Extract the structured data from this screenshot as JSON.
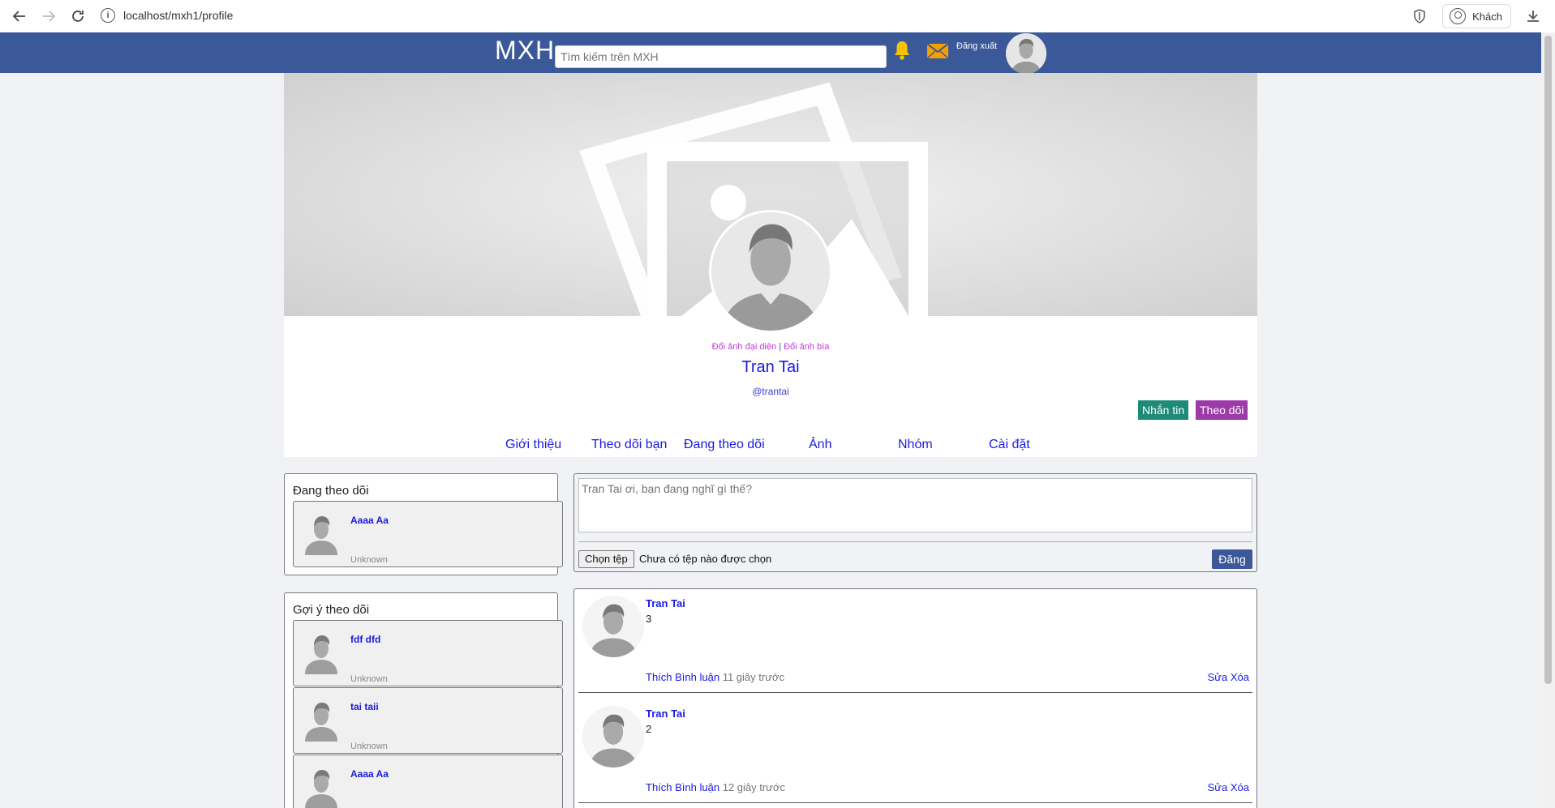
{
  "browser": {
    "url": "localhost/mxh1/profile",
    "profile_label": "Khách"
  },
  "header": {
    "brand": "MXH",
    "search_placeholder": "Tìm kiếm trên MXH",
    "logout_label": "Đăng xuất"
  },
  "profile": {
    "change_avatar": "Đổi ảnh đại diện",
    "separator": "|",
    "change_cover": "Đổi ảnh bìa",
    "name": "Tran Tai",
    "handle": "@trantai",
    "message_button": "Nhắn tin",
    "follow_button": "Theo dõi",
    "tabs": [
      "Giới thiệu",
      "Theo dõi bạn",
      "Đang theo dõi",
      "Ảnh",
      "Nhóm",
      "Cài đặt"
    ]
  },
  "following": {
    "title": "Đang theo dõi",
    "users": [
      {
        "name": "Aaaa Aa",
        "status": "Unknown"
      }
    ]
  },
  "suggestions": {
    "title": "Gợi ý theo dõi",
    "users": [
      {
        "name": "fdf dfd",
        "status": "Unknown"
      },
      {
        "name": "tai taii",
        "status": "Unknown"
      },
      {
        "name": "Aaaa Aa",
        "status": ""
      }
    ]
  },
  "composer": {
    "placeholder": "Tran Tai ơi, bạn đang nghĩ gì thế?",
    "file_button": "Chọn tệp",
    "file_status": "Chưa có tệp nào được chọn",
    "post_button": "Đăng"
  },
  "posts": [
    {
      "author": "Tran Tai",
      "content": "3",
      "like": "Thích",
      "comment": "Bình luận",
      "time": "11 giây trước",
      "edit": "Sửa",
      "delete": "Xóa"
    },
    {
      "author": "Tran Tai",
      "content": "2",
      "like": "Thích",
      "comment": "Bình luận",
      "time": "12 giây trước",
      "edit": "Sửa",
      "delete": "Xóa"
    }
  ],
  "colors": {
    "header_bg": "#3b5998",
    "link_blue": "#1a1ae0",
    "message_btn": "#1e8a78",
    "follow_btn": "#9c3aa8",
    "change_links": "#c03ad8"
  }
}
